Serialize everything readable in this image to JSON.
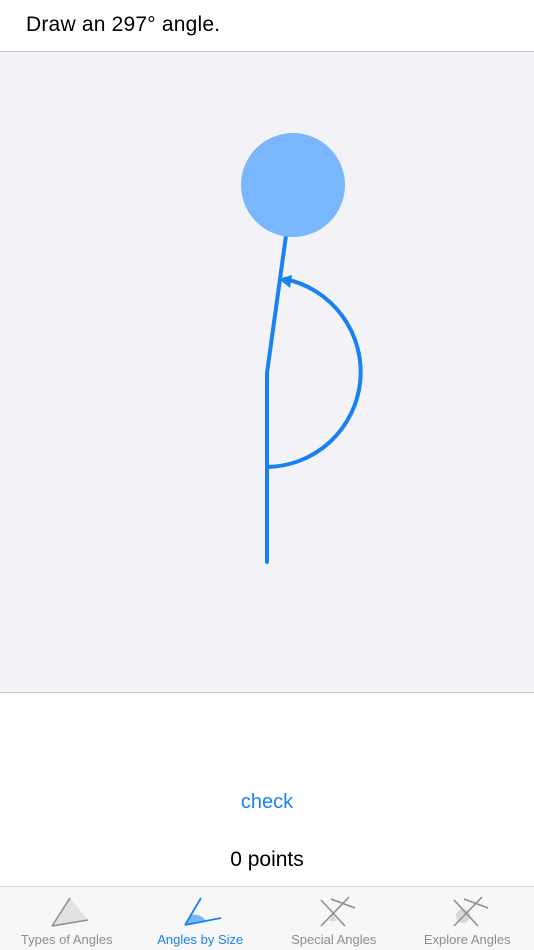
{
  "header": {
    "prompt": "Draw an 297° angle."
  },
  "canvas": {
    "line_color": "#1a82f0",
    "handle_color": "#7ab6fb"
  },
  "actions": {
    "check_label": "check",
    "score_label": "0 points"
  },
  "tabbar": {
    "active_color": "#1a82f0",
    "inactive_color": "#8e8e93",
    "tabs": [
      {
        "label": "Types of Angles",
        "icon": "types-of-angles-icon",
        "active": false
      },
      {
        "label": "Angles by Size",
        "icon": "angles-by-size-icon",
        "active": true
      },
      {
        "label": "Special Angles",
        "icon": "special-angles-icon",
        "active": false
      },
      {
        "label": "Explore Angles",
        "icon": "explore-angles-icon",
        "active": false
      }
    ]
  }
}
